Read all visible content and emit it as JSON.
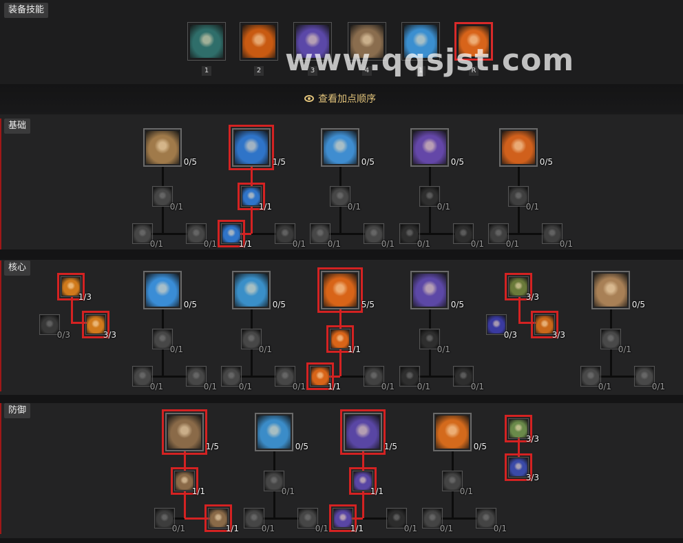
{
  "equipped": {
    "label": "装备技能",
    "slots": [
      {
        "key": "1",
        "icon": "spiral-rune-icon",
        "color": "#2f6e6a"
      },
      {
        "key": "2",
        "icon": "flame-fist-icon",
        "color": "#c85a12"
      },
      {
        "key": "3",
        "icon": "wolf-head-icon",
        "color": "#5b48a8"
      },
      {
        "key": "4",
        "icon": "stone-golem-icon",
        "color": "#8a6d4e"
      },
      {
        "key": "1",
        "icon": "lightning-spear-icon",
        "color": "#3b8fd0"
      },
      {
        "key": "R",
        "icon": "sun-claw-icon",
        "color": "#d8641a"
      }
    ]
  },
  "watermark": "www.qqsjst.com",
  "view_order": "查看加点顺序",
  "sections": {
    "basic": "基础",
    "core": "核心",
    "defense": "防御"
  },
  "basic": [
    {
      "icon": "earth-spike-icon",
      "color": "#a07a4a",
      "points": "0/5",
      "up": "0/1",
      "left": "0/1",
      "right": "0/1"
    },
    {
      "icon": "wind-shear-icon",
      "color": "#2f74c8",
      "points": "1/5",
      "up": "1/1",
      "left": "1/1",
      "right": "0/1"
    },
    {
      "icon": "storm-strike-icon",
      "color": "#3f8dd0",
      "points": "0/5",
      "up": "0/1",
      "left": "0/1",
      "right": "0/1"
    },
    {
      "icon": "claw-icon",
      "color": "#6447a8",
      "points": "0/5",
      "up": "0/1",
      "left": "0/1",
      "right": "0/1"
    },
    {
      "icon": "maul-icon",
      "color": "#d0601c",
      "points": "0/5",
      "up": "0/1",
      "left": "0/1",
      "right": "0/1"
    }
  ],
  "core_side_left": {
    "top": "1/3",
    "left": "0/3",
    "right": "3/3"
  },
  "core": [
    {
      "icon": "lightning-storm-icon",
      "color": "#3a8dd6",
      "points": "0/5",
      "up": "0/1",
      "left": "0/1",
      "right": "0/1"
    },
    {
      "icon": "tornado-icon",
      "color": "#3a8fc8",
      "points": "0/5",
      "up": "0/1",
      "left": "0/1",
      "right": "0/1"
    },
    {
      "icon": "pulverize-icon",
      "color": "#d86418",
      "points": "5/5",
      "up": "1/1",
      "left": "1/1",
      "right": "0/1"
    },
    {
      "icon": "shred-icon",
      "color": "#5c48a6",
      "points": "0/5",
      "up": "0/1",
      "left": "0/1",
      "right": "0/1"
    },
    {
      "icon": "landslide-icon",
      "color": "#a88056",
      "points": "0/5",
      "up": "0/1",
      "left": "0/1",
      "right": "0/1"
    }
  ],
  "core_side_right": {
    "top": "3/3",
    "left": "0/3",
    "right": "3/3"
  },
  "defense": [
    {
      "icon": "earthen-bulwark-icon",
      "color": "#8a6a48",
      "points": "1/5",
      "up": "1/1",
      "left": "0/1",
      "right": "1/1"
    },
    {
      "icon": "cyclone-armor-icon",
      "color": "#3b8cc8",
      "points": "0/5",
      "up": "0/1",
      "left": "0/1",
      "right": "0/1"
    },
    {
      "icon": "blood-howl-icon",
      "color": "#5946a4",
      "points": "1/5",
      "up": "1/1",
      "left": "1/1",
      "right": "0/1"
    },
    {
      "icon": "debilitating-roar-icon",
      "color": "#d46a1c",
      "points": "0/5",
      "up": "0/1",
      "left": "0/1",
      "right": "0/1"
    }
  ],
  "defense_side": {
    "top": "3/3",
    "bottom": "3/3"
  }
}
